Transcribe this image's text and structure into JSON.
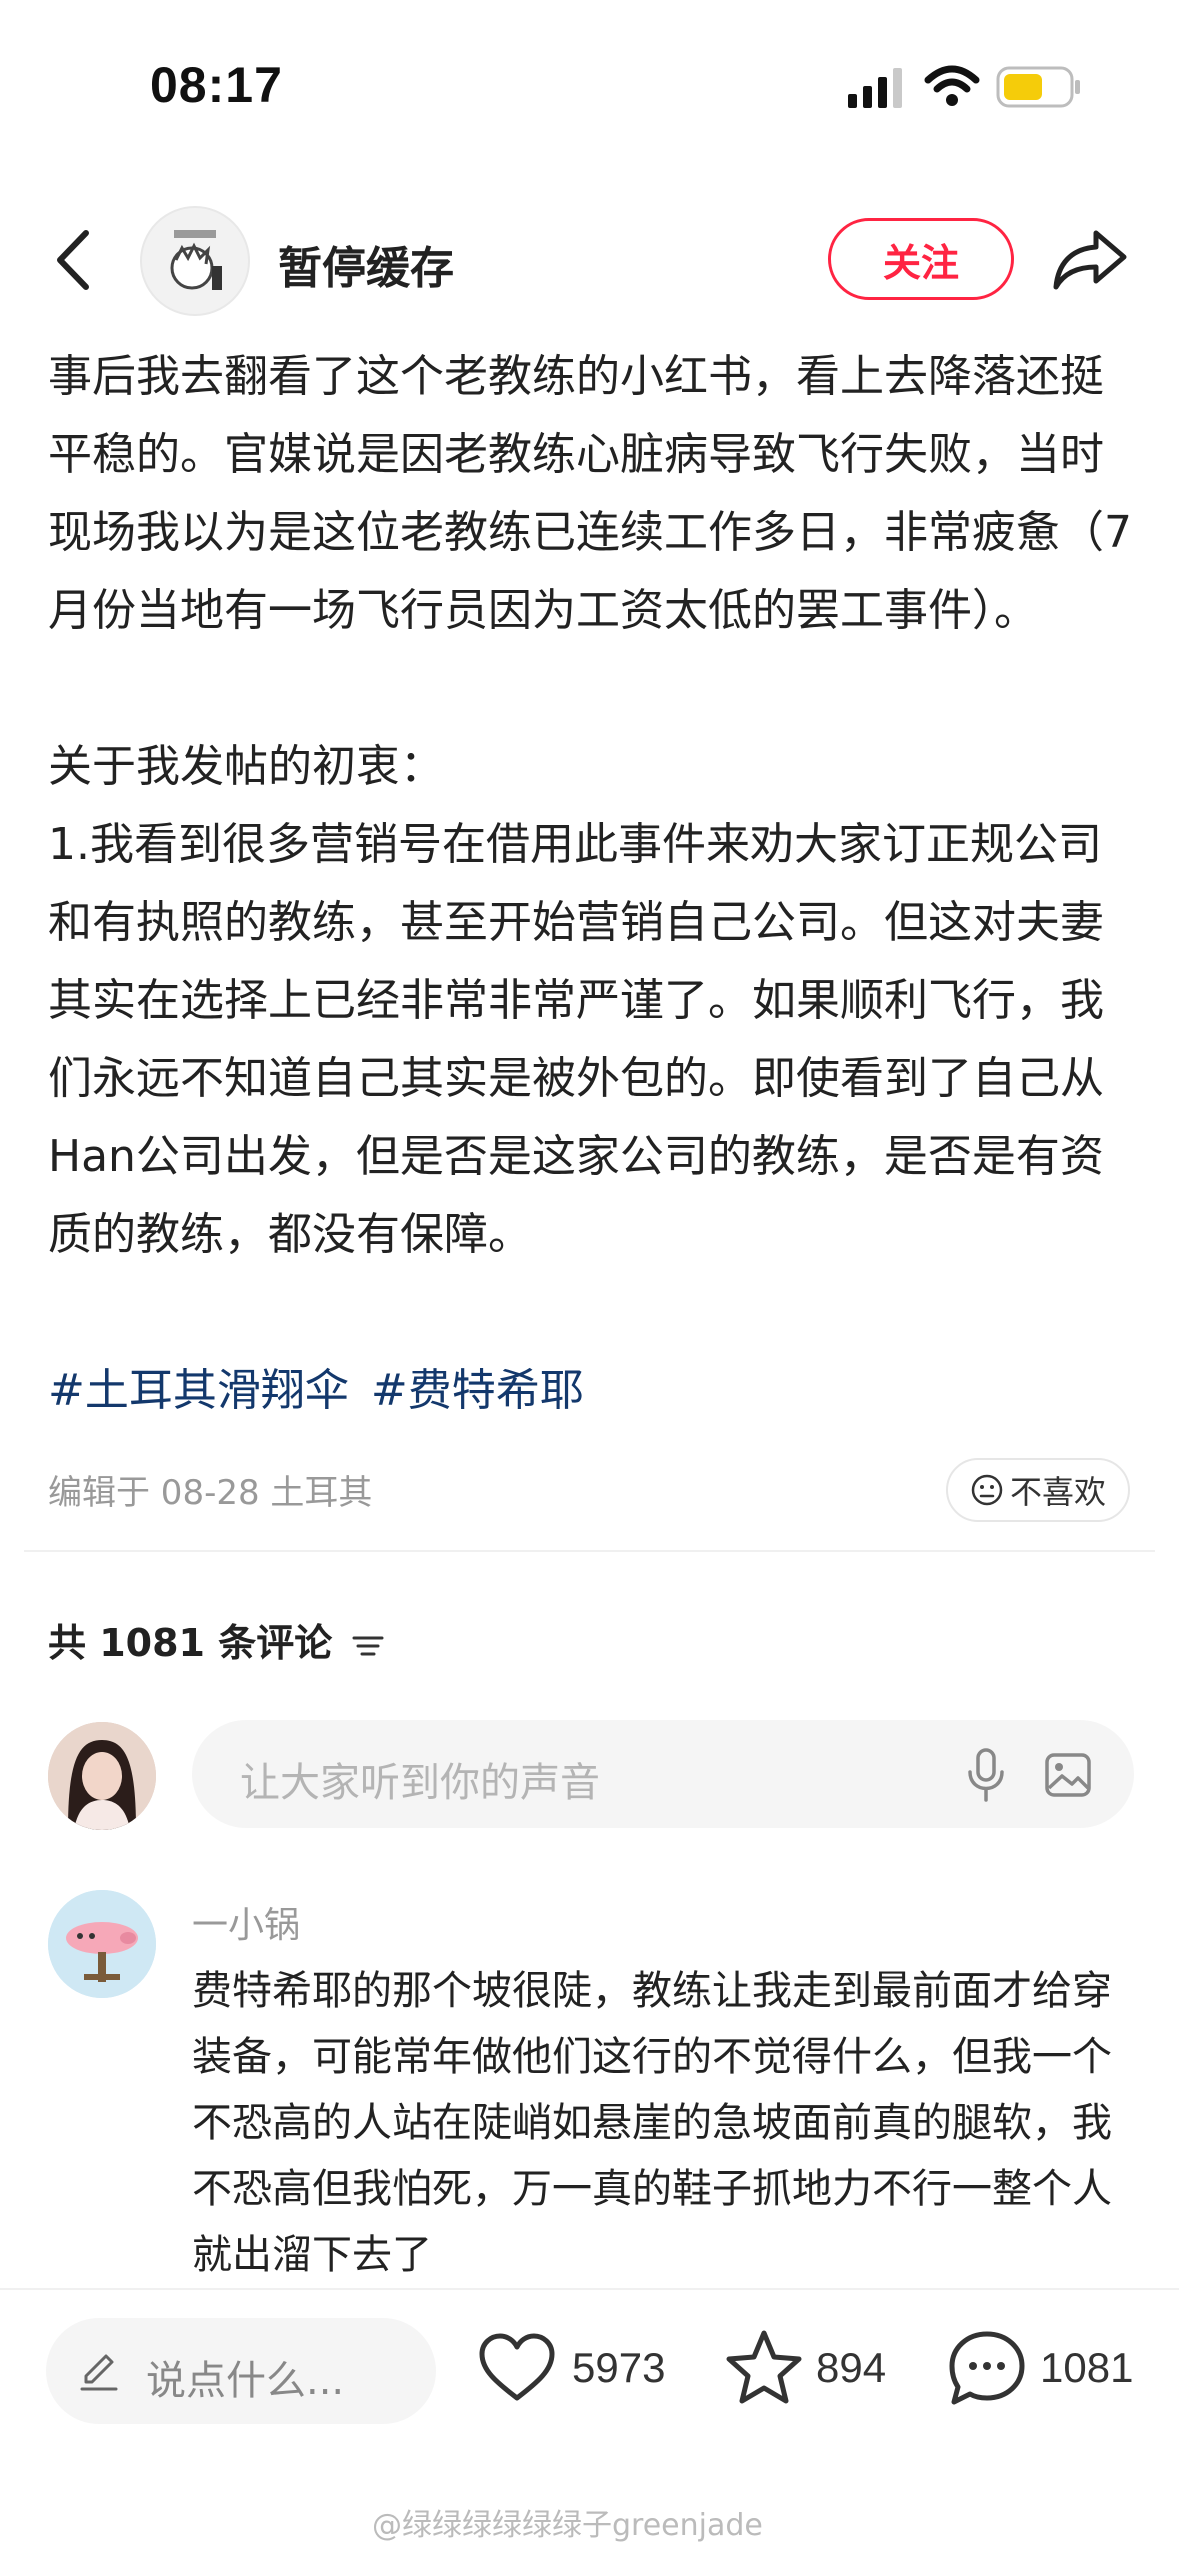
{
  "status_bar": {
    "time": "08:17"
  },
  "header": {
    "author_name": "暂停缓存",
    "follow_label": "关注"
  },
  "post": {
    "paragraphs": [
      "事后我去翻看了这个老教练的小红书，看上去降落还挺平稳的。官媒说是因老教练心脏病导致飞行失败，当时现场我以为是这位老教练已连续工作多日，非常疲惫（7月份当地有一场飞行员因为工资太低的罢工事件）。",
      "",
      "关于我发帖的初衷：",
      "1.我看到很多营销号在借用此事件来劝大家订正规公司和有执照的教练，甚至开始营销自己公司。但这对夫妻其实在选择上已经非常非常严谨了。如果顺利飞行，我们永远不知道自己其实是被外包的。即使看到了自己从Han公司出发，但是否是这家公司的教练，是否是有资质的教练，都没有保障。"
    ],
    "hashtags": [
      "#土耳其滑翔伞",
      "#费特希耶"
    ],
    "edit_meta": "编辑于 08-28 土耳其",
    "dislike_label": "不喜欢"
  },
  "comments": {
    "count_label": "共 1081 条评论",
    "input_placeholder": "让大家听到你的声音",
    "items": [
      {
        "user": "一小锅",
        "text": "费特希耶的那个坡很陡，教练让我走到最前面才给穿装备，可能常年做他们这行的不觉得什么，但我一个不恐高的人站在陡峭如悬崖的急坡面前真的腿软，我不恐高但我怕死，万一真的鞋子抓地力不行一整个人就出溜下去了"
      }
    ]
  },
  "bottom_bar": {
    "say_placeholder": "说点什么...",
    "likes": "5973",
    "collects": "894",
    "comments": "1081"
  },
  "watermark": "@绿绿绿绿绿绿子greenjade",
  "colors": {
    "accent": "#ff2442",
    "hashtag": "#13386c"
  },
  "icons": [
    "back-icon",
    "share-icon",
    "wifi-icon",
    "signal-icon",
    "battery-icon",
    "sort-icon",
    "mic-icon",
    "image-icon",
    "pencil-icon",
    "heart-icon",
    "star-icon",
    "comment-icon",
    "face-icon"
  ]
}
